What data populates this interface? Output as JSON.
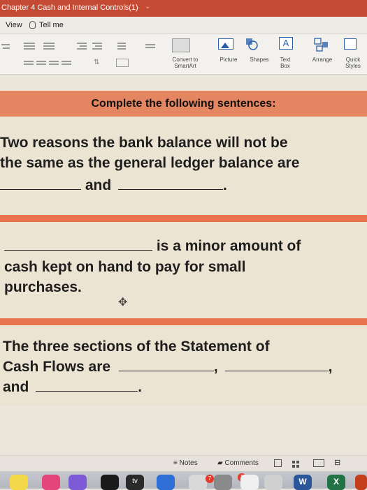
{
  "window": {
    "title": "Chapter 4 Cash and Internal Controls(1)"
  },
  "menu": {
    "view": "View",
    "tell_me": "Tell me"
  },
  "ribbon": {
    "convert_smartart": [
      "Convert to",
      "SmartArt"
    ],
    "picture": "Picture",
    "shapes": "Shapes",
    "text_box": [
      "Text",
      "Box"
    ],
    "arrange": "Arrange",
    "quick_styles": [
      "Quick",
      "Styles"
    ]
  },
  "slide": {
    "heading": "Complete the following sentences:",
    "q1": {
      "line1": "Two reasons the bank balance will not be",
      "line2": "the same as the general ledger balance are",
      "and": "and",
      "end": "."
    },
    "q2": {
      "line1": "is a minor amount of",
      "line2": "cash kept on hand to pay for small",
      "line3": "purchases."
    },
    "q3": {
      "line1": "The three sections of the Statement of",
      "line2": "Cash Flows are",
      "comma": ",",
      "and": "and",
      "end": "."
    }
  },
  "status": {
    "notes": "Notes",
    "comments": "Comments"
  },
  "dock": {
    "tv_label": "tv",
    "badge1": "7",
    "badge2": "1",
    "word": "W",
    "excel": "X"
  },
  "colors": {
    "title_bar": "#c54a33",
    "accent_rule": "#e8744f",
    "heading_fill": "#e58663",
    "card_fill": "#ece4d2"
  }
}
